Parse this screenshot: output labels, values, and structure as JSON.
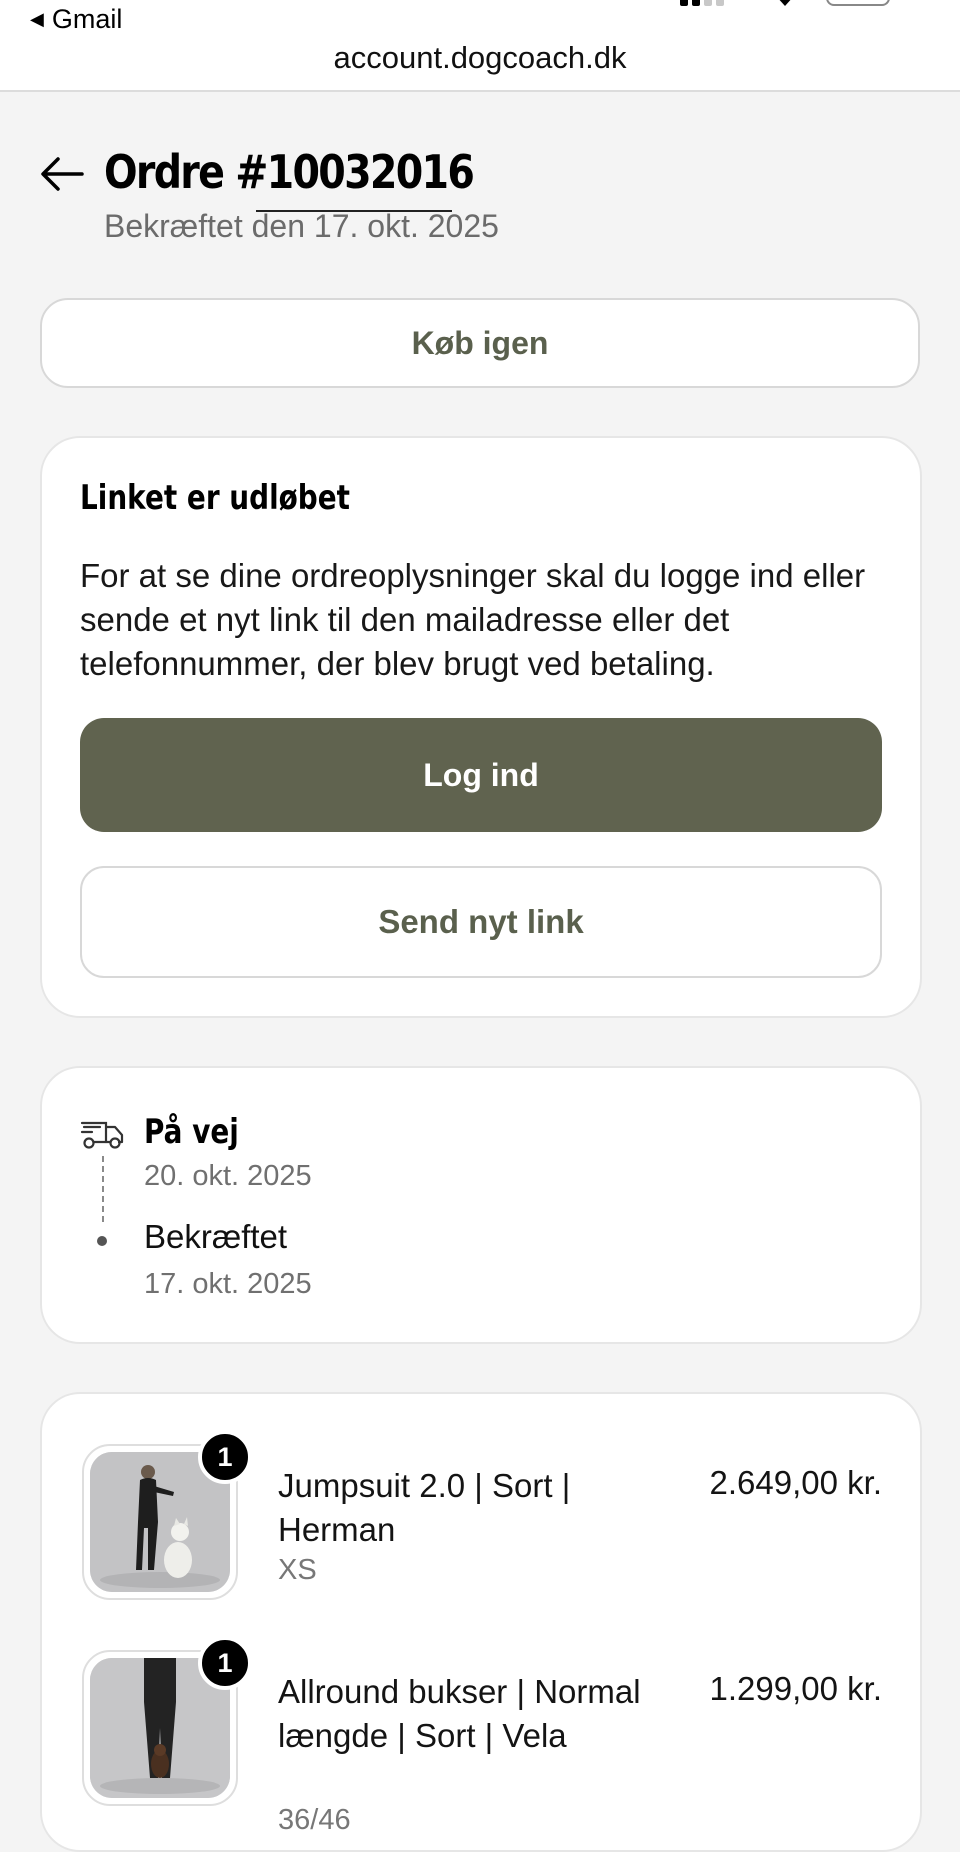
{
  "browser": {
    "back_app_label": "Gmail",
    "url": "account.dogcoach.dk"
  },
  "header": {
    "title": "Ordre #10032016",
    "subtitle": "Bekræftet den 17. okt. 2025"
  },
  "actions": {
    "buy_again_label": "Køb igen"
  },
  "login_card": {
    "heading": "Linket er udløbet",
    "text": "For at se dine ordreoplysninger skal du logge ind eller sende et nyt link til den mailadresse eller det telefonnummer, der blev brugt ved betaling.",
    "login_label": "Log ind",
    "send_link_label": "Send nyt link"
  },
  "status": {
    "icon": "truck-icon",
    "steps": [
      {
        "label": "På vej",
        "date": "20. okt. 2025"
      },
      {
        "label": "Bekræftet",
        "date": "17. okt. 2025"
      }
    ]
  },
  "items": [
    {
      "quantity": "1",
      "name": "Jumpsuit 2.0 | Sort | Herman",
      "variant": "XS",
      "price": "2.649,00 kr."
    },
    {
      "quantity": "1",
      "name": "Allround bukser | Normal længde | Sort | Vela",
      "variant": "36/46",
      "price": "1.299,00 kr."
    }
  ],
  "colors": {
    "accent": "#60634f",
    "outline_button_text": "#5a604d",
    "page_background": "#f4f4f4"
  }
}
